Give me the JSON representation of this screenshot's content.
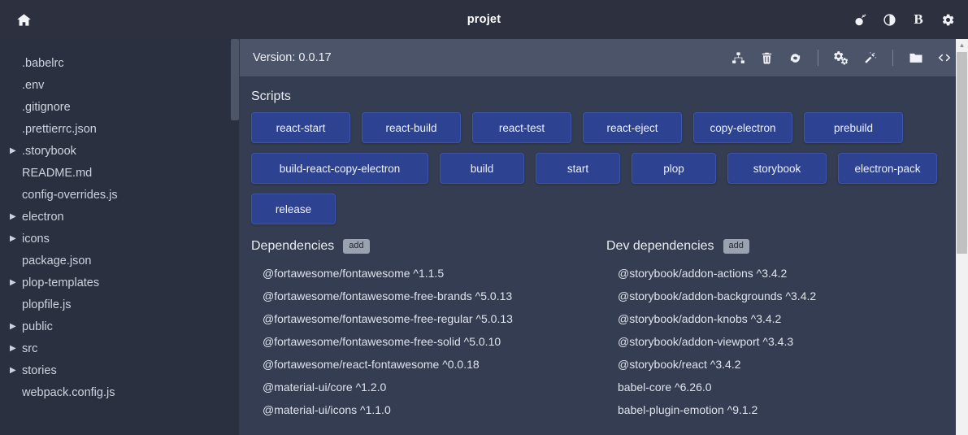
{
  "titlebar": {
    "home_icon": "home-icon",
    "title": "projet",
    "right_icons": [
      {
        "name": "bomb-icon",
        "label": "•"
      },
      {
        "name": "contrast-icon",
        "label": "◐"
      },
      {
        "name": "bold-b-icon",
        "label": "B"
      },
      {
        "name": "gear-icon",
        "label": "⚙"
      }
    ]
  },
  "sidebar": {
    "items": [
      {
        "label": ".babelrc",
        "folder": false
      },
      {
        "label": ".env",
        "folder": false
      },
      {
        "label": ".gitignore",
        "folder": false
      },
      {
        "label": ".prettierrc.json",
        "folder": false
      },
      {
        "label": ".storybook",
        "folder": true
      },
      {
        "label": "README.md",
        "folder": false
      },
      {
        "label": "config-overrides.js",
        "folder": false
      },
      {
        "label": "electron",
        "folder": true
      },
      {
        "label": "icons",
        "folder": true
      },
      {
        "label": "package.json",
        "folder": false
      },
      {
        "label": "plop-templates",
        "folder": true
      },
      {
        "label": "plopfile.js",
        "folder": false
      },
      {
        "label": "public",
        "folder": true
      },
      {
        "label": "src",
        "folder": true
      },
      {
        "label": "stories",
        "folder": true
      },
      {
        "label": "webpack.config.js",
        "folder": false
      }
    ],
    "caret": "▶"
  },
  "version_bar": {
    "version_text": "Version: 0.0.17",
    "actions": [
      {
        "name": "sitemap-icon"
      },
      {
        "name": "trash-icon"
      },
      {
        "name": "refresh-icon"
      },
      {
        "name": "separator"
      },
      {
        "name": "cogs-icon"
      },
      {
        "name": "magic-wand-icon"
      },
      {
        "name": "separator"
      },
      {
        "name": "folder-icon"
      },
      {
        "name": "code-icon"
      }
    ]
  },
  "scripts": {
    "heading": "Scripts",
    "buttons": [
      {
        "label": "react-start",
        "size": "med"
      },
      {
        "label": "react-build",
        "size": "med"
      },
      {
        "label": "react-test",
        "size": "med"
      },
      {
        "label": "react-eject",
        "size": "med"
      },
      {
        "label": "copy-electron",
        "size": "med"
      },
      {
        "label": "prebuild",
        "size": "med"
      },
      {
        "label": "build-react-copy-electron",
        "size": "wide"
      },
      {
        "label": "build",
        "size": "normal"
      },
      {
        "label": "start",
        "size": "normal"
      },
      {
        "label": "plop",
        "size": "normal"
      },
      {
        "label": "storybook",
        "size": "med"
      },
      {
        "label": "electron-pack",
        "size": "med"
      },
      {
        "label": "release",
        "size": "normal"
      }
    ]
  },
  "dependencies": {
    "heading": "Dependencies",
    "add_label": "add",
    "items": [
      "@fortawesome/fontawesome ^1.1.5",
      "@fortawesome/fontawesome-free-brands ^5.0.13",
      "@fortawesome/fontawesome-free-regular ^5.0.13",
      "@fortawesome/fontawesome-free-solid ^5.0.10",
      "@fortawesome/react-fontawesome ^0.0.18",
      "@material-ui/core ^1.2.0",
      "@material-ui/icons ^1.1.0"
    ]
  },
  "dev_dependencies": {
    "heading": "Dev dependencies",
    "add_label": "add",
    "items": [
      "@storybook/addon-actions ^3.4.2",
      "@storybook/addon-backgrounds ^3.4.2",
      "@storybook/addon-knobs ^3.4.2",
      "@storybook/addon-viewport ^3.4.3",
      "@storybook/react ^3.4.2",
      "babel-core ^6.26.0",
      "babel-plugin-emotion ^9.1.2"
    ]
  },
  "colors": {
    "titlebar_bg": "#2c303f",
    "sidebar_bg": "#2b3040",
    "main_bg": "#343d52",
    "version_bar_bg": "#4b5468",
    "script_button_bg": "#2d4391",
    "add_badge_bg": "#9aa1b0",
    "text_primary": "#e9ecf2"
  }
}
